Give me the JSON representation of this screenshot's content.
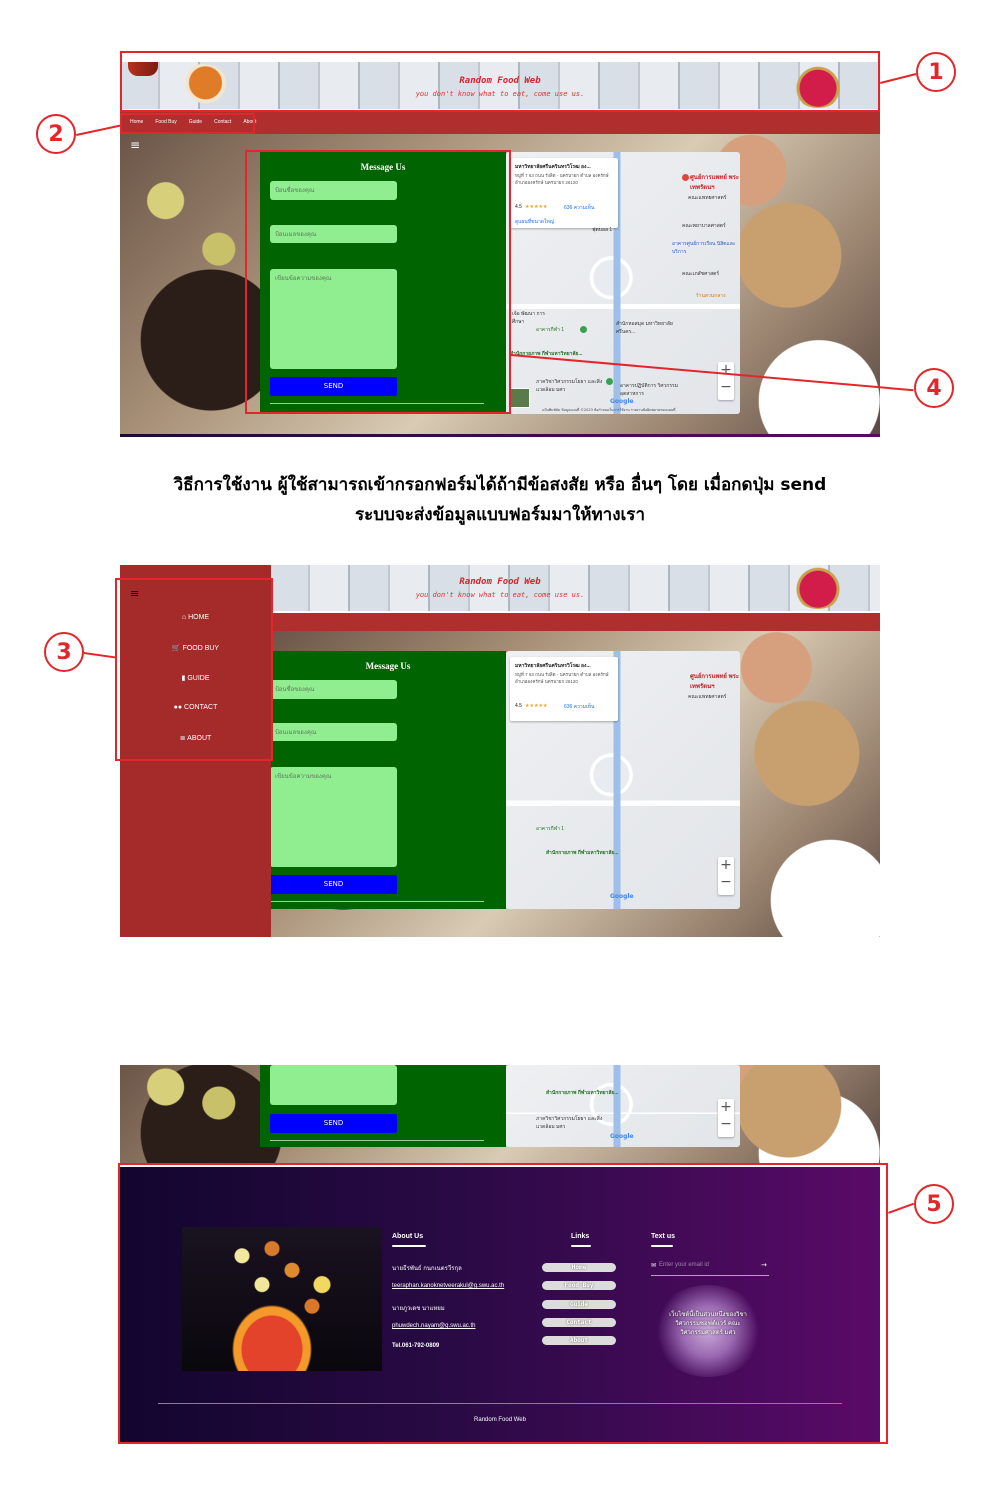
{
  "header": {
    "brand": "Random Food Web",
    "tagline": "you don't know what to eat, come use us."
  },
  "nav": {
    "items": [
      "Home",
      "Food Buy",
      "Guide",
      "Contact",
      "About"
    ]
  },
  "menu_icon": "≡",
  "form": {
    "title": "Message Us",
    "name_placeholder": "ป้อนชื่อของคุณ",
    "email_placeholder": "ป้อนเมลของคุณ",
    "message_placeholder": "เขียนข้อความของคุณ",
    "send_label": "SEND"
  },
  "map": {
    "place_name": "มหาวิทยาลัยศรีนครินทรวิโรฒ อง...",
    "address": "หมู่ที่ 7 63 ถนน รังสิต - นครนายก ตำบล องครักษ์ อำเภอองครักษ์ นครนายก 26120",
    "rating": "4.5",
    "stars": "★★★★★",
    "reviews": "636 ความเห็น",
    "larger_map": "ดูแผนที่ขนาดใหญ่",
    "labels": {
      "hospital": "ศูนย์การแพทย์ พระเทพรัตนฯ",
      "faculty_medicine": "คณะแพทยศาสตร์",
      "faculty_nursing": "คณะพยาบาลศาสตร์",
      "faculty_pharmacy": "คณะเภสัชศาสตร์",
      "center": "อาคารศูนย์การเรียน นิสิตและบริการ",
      "library": "สำนักหอสมุด มหาวิทยาลัยศรีนคร...",
      "sports": "อาคารกีฬา 1",
      "stadium": "สำนักกายภาพ กีฬามหาวิทยาลัย...",
      "dorm": "ภาควิชาวิศวกรรมโยธา และสิ่งแวดล้อม มศว",
      "lab": "อาคารปฏิบัติการ วิศวกรรมอุตสาหการ",
      "google": "Google",
      "footer": "แป้นพิมพ์ลัด   ข้อมูลแผนที่ ©2023   ข้อกำหนดในการใช้งาน   รายงานข้อผิดพลาดของแผนที่",
      "road": "ฟุตบอล 1",
      "park": "ร้านสวนกลาง",
      "left_area": "เจ้อ พัฒนา การศึกษา"
    },
    "zoom_in": "+",
    "zoom_out": "−"
  },
  "callouts": [
    "1",
    "2",
    "3",
    "4",
    "5"
  ],
  "instructions": {
    "line1": "วิธีการใช้งาน ผู้ใช้สามารถเข้ากรอกฟอร์มได้ถ้ามีข้อสงสัย หรือ อื่นๆ โดย เมื่อกดปุ่ม send",
    "line2": "ระบบจะส่งข้อมูลแบบฟอร์มมาให้ทางเรา"
  },
  "side_nav": {
    "icon": "≡",
    "items": [
      {
        "icon": "home-icon",
        "label": "HOME"
      },
      {
        "icon": "cart-icon",
        "label": "FOOD BUY"
      },
      {
        "icon": "book-icon",
        "label": "GUIDE"
      },
      {
        "icon": "users-icon",
        "label": "CONTACT"
      },
      {
        "icon": "database-icon",
        "label": "ABOUT"
      }
    ]
  },
  "footer": {
    "about_title": "About Us",
    "person1": "นายธีรพันธ์ กนกเนตรวีรกุล",
    "email1": "teeraphan.kanoknetveerakul@g.swu.ac.th",
    "person2": "นายภูวเดช นาแหยม",
    "email2": "phuwdech.nayam@g.swu.ac.th",
    "tel": "Tel.061-792-0809",
    "links_title": "Links",
    "links": [
      "Home",
      "Food Buy",
      "Guide",
      "Contact",
      "About"
    ],
    "text_title": "Text us",
    "email_placeholder": "Enter your email id",
    "glow_text": "เว็บไซต์นี้เป็นส่วนหนึ่งของวิชาวิศวกรรมซอฟต์แวร์ คณะวิศวกรรมศาสตร์ มศว",
    "copyright": "Random Food Web"
  },
  "colors": {
    "form_green": "#006400",
    "input_green": "#90ee90",
    "send_blue": "#0000ff",
    "nav_red": "#b02e2e",
    "side_red": "#a52a2a",
    "callout_red": "#e3262b",
    "footer_purple": "#5a0a68"
  }
}
